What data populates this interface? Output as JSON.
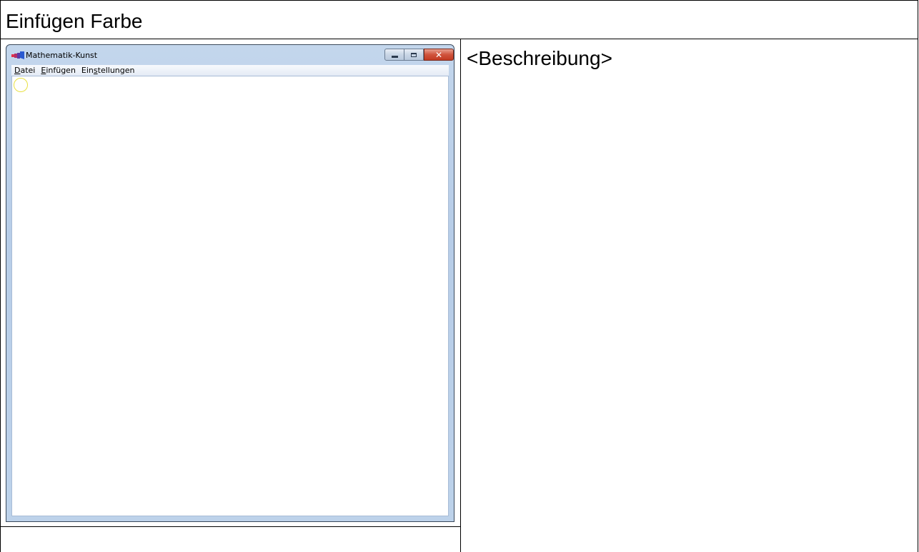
{
  "document": {
    "heading": "Einfügen Farbe",
    "description": "<Beschreibung>"
  },
  "window": {
    "title": "Mathematik-Kunst",
    "icon": "app-icon",
    "controls": [
      "minimize-icon",
      "maximize-icon",
      "close-icon"
    ],
    "menu": [
      {
        "pre": "",
        "accel": "D",
        "post": "atei"
      },
      {
        "pre": "",
        "accel": "E",
        "post": "infügen"
      },
      {
        "pre": "Ein",
        "accel": "s",
        "post": "tellungen"
      }
    ],
    "close_glyph": "✕"
  },
  "colors": {
    "circle_stroke": "#e8e040",
    "close_button": "#c94a33"
  }
}
